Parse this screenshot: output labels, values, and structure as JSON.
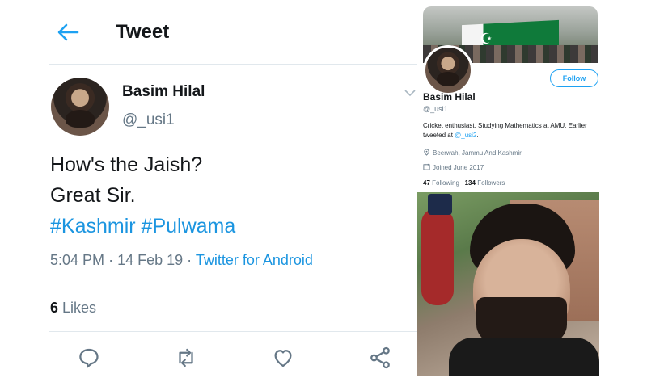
{
  "header": {
    "title": "Tweet",
    "back_icon": "arrow-left-icon"
  },
  "tweet": {
    "author_name": "Basim Hilal",
    "author_handle": "@_usi1",
    "body_lines": [
      "How's the Jaish?",
      "Great Sir."
    ],
    "hashtags": [
      "#Kashmir",
      "#Pulwama"
    ],
    "time": "5:04 PM",
    "separator": "·",
    "date": "14 Feb 19",
    "source": "Twitter for Android",
    "likes_count": "6",
    "likes_label": "Likes",
    "actions": [
      "reply-icon",
      "retweet-icon",
      "like-icon",
      "share-icon"
    ]
  },
  "profile": {
    "name": "Basim Hilal",
    "handle": "@_usi1",
    "follow_label": "Follow",
    "bio_text": "Cricket enthusiast. Studying Mathematics at AMU. Earlier tweeted at ",
    "bio_mention": "@_usi2",
    "bio_end": ".",
    "location": "Beerwah, Jammu And Kashmir",
    "joined": "Joined June 2017",
    "following_count": "47",
    "following_label": "Following",
    "followers_count": "134",
    "followers_label": "Followers"
  },
  "colors": {
    "accent": "#1da1f2",
    "link": "#1b95e0",
    "muted": "#657786",
    "text": "#14171a"
  }
}
